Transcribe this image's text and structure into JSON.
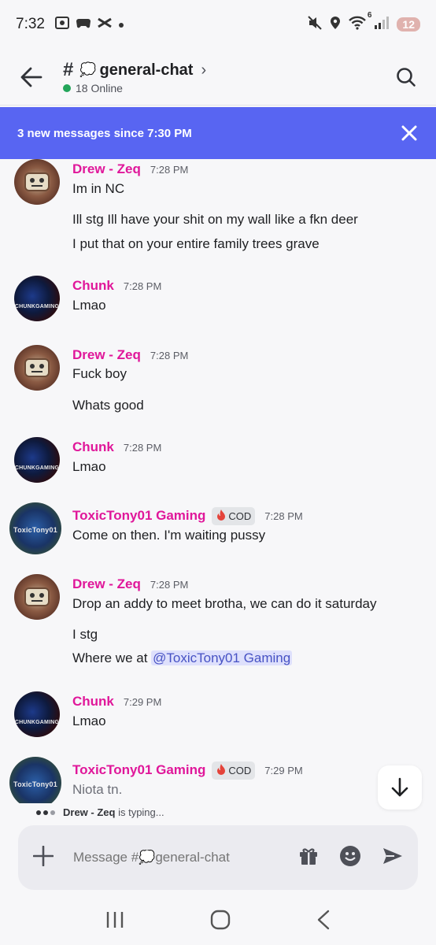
{
  "status_bar": {
    "time": "7:32",
    "wifi_label": "6",
    "battery": "12"
  },
  "header": {
    "hash": "#",
    "channel_emoji": "💭",
    "channel_name": "general-chat",
    "chevron": "›",
    "online": "18 Online"
  },
  "banner": {
    "text": "3 new messages since 7:30 PM"
  },
  "messages": [
    {
      "author": "Drew - Zeq",
      "time": "7:28 PM",
      "avatar": "drew",
      "lines": [
        "Im in NC",
        "Ill stg Ill have your shit on my wall like a fkn deer",
        "I put that on your entire family trees grave"
      ]
    },
    {
      "author": "Chunk",
      "time": "7:28 PM",
      "avatar": "chunk",
      "avatar_text": "CHUNKGAMING",
      "lines": [
        "Lmao"
      ]
    },
    {
      "author": "Drew - Zeq",
      "time": "7:28 PM",
      "avatar": "drew",
      "lines": [
        "Fuck boy",
        "Whats good"
      ]
    },
    {
      "author": "Chunk",
      "time": "7:28 PM",
      "avatar": "chunk",
      "avatar_text": "CHUNKGAMING",
      "lines": [
        "Lmao"
      ]
    },
    {
      "author": "ToxicTony01 Gaming",
      "badge": "COD",
      "time": "7:28 PM",
      "avatar": "toxic",
      "avatar_text": "ToxicTony01",
      "lines": [
        "Come on then. I'm waiting pussy"
      ]
    },
    {
      "author": "Drew - Zeq",
      "time": "7:28 PM",
      "avatar": "drew",
      "lines": [
        "Drop an addy to meet brotha, we can do it saturday",
        "I stg"
      ],
      "mention_line": {
        "prefix": "Where we at ",
        "mention": "@ToxicTony01 Gaming"
      }
    },
    {
      "author": "Chunk",
      "time": "7:29 PM",
      "avatar": "chunk",
      "avatar_text": "CHUNKGAMING",
      "lines": [
        "Lmao"
      ]
    },
    {
      "author": "ToxicTony01 Gaming",
      "badge": "COD",
      "time": "7:29 PM",
      "avatar": "toxic",
      "avatar_text": "ToxicTony01",
      "lines": [
        "Niota tn."
      ]
    }
  ],
  "typing": {
    "user": "Drew - Zeq",
    "suffix": " is typing..."
  },
  "composer": {
    "placeholder": "Message #💭general-chat"
  },
  "colors": {
    "accent": "#5865f2",
    "author": "#e0179a",
    "online": "#23a55a"
  },
  "icons": [
    "back-arrow-icon",
    "search-icon",
    "close-icon",
    "arrow-down-icon",
    "plus-icon",
    "gift-icon",
    "emoji-icon",
    "send-icon"
  ]
}
